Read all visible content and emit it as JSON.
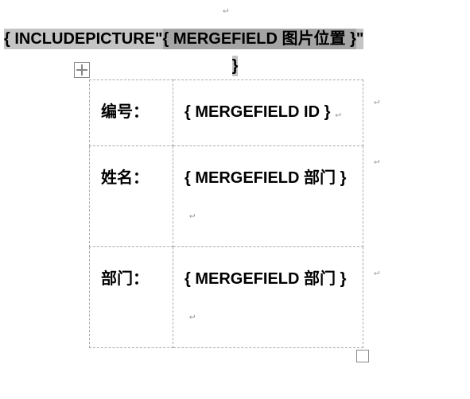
{
  "topField": {
    "outerPrefix": "{ INCLUDEPICTURE\"",
    "inner": "{ MERGEFIELD  图片位置  }",
    "outerSuffixLine1": "\"",
    "outerSuffixLine2": "}"
  },
  "table": {
    "rows": [
      {
        "label": "编号：",
        "value": "{ MERGEFIELD ID }"
      },
      {
        "label": "姓名：",
        "value": "{ MERGEFIELD  部门 }"
      },
      {
        "label": "部门：",
        "value": "{ MERGEFIELD  部门 }"
      }
    ]
  },
  "marks": {
    "return": "↵"
  }
}
